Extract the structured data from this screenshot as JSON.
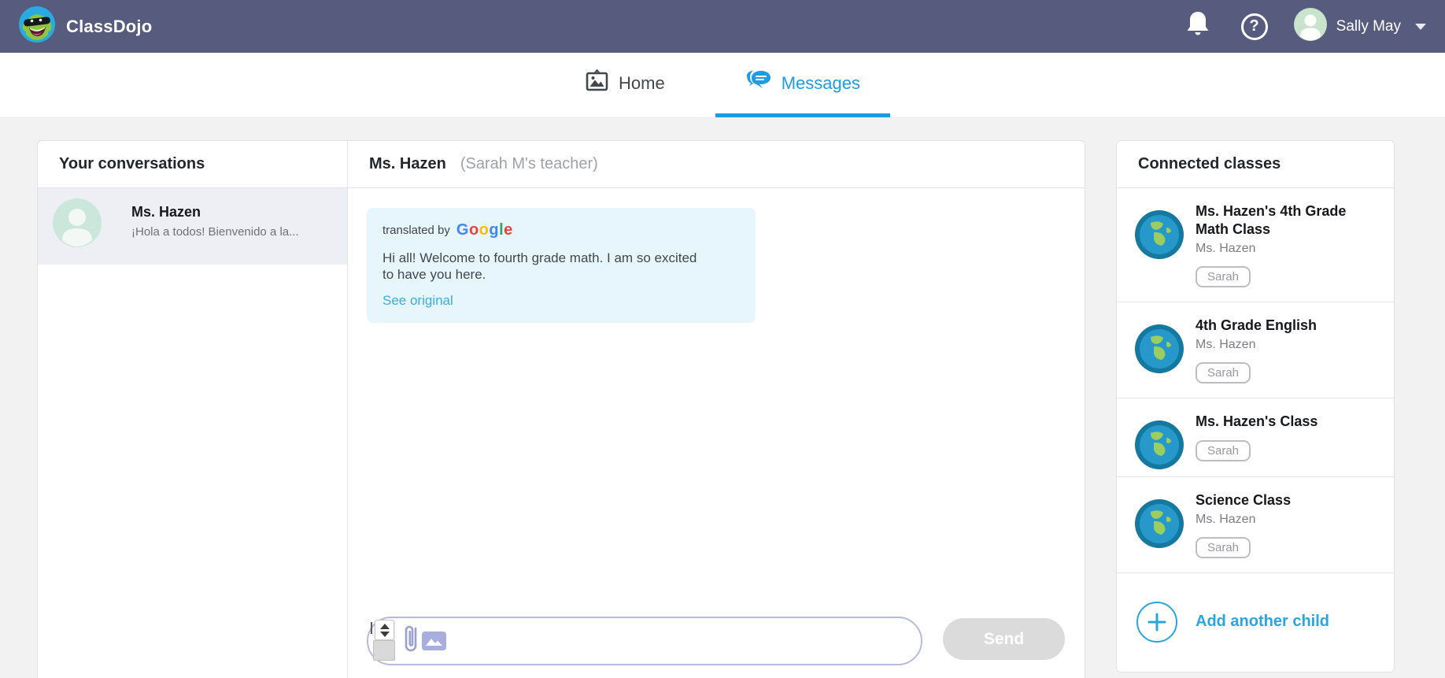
{
  "navbar": {
    "brand": "ClassDojo",
    "user_name": "Sally May",
    "help_glyph": "?"
  },
  "tabs": {
    "home_label": "Home",
    "messages_label": "Messages",
    "active_tab": "Messages"
  },
  "conversations": {
    "title": "Your conversations",
    "items": [
      {
        "name": "Ms. Hazen",
        "preview": "¡Hola a todos! Bienvenido a la..."
      }
    ]
  },
  "thread": {
    "name": "Ms. Hazen",
    "subtitle": "(Sarah M's teacher)",
    "message": {
      "translated_by": "translated by",
      "google_letters": [
        "G",
        "o",
        "o",
        "g",
        "l",
        "e"
      ],
      "text": "Hi all! Welcome to fourth grade math. I am so excited to have you here.",
      "see_original": "See original"
    },
    "composer": {
      "value": "",
      "send_label": "Send"
    }
  },
  "connected_classes": {
    "title": "Connected classes",
    "items": [
      {
        "name": "Ms. Hazen's 4th Grade Math Class",
        "teacher": "Ms. Hazen",
        "student_tag": "Sarah"
      },
      {
        "name": "4th Grade English",
        "teacher": "Ms. Hazen",
        "student_tag": "Sarah"
      },
      {
        "name": "Ms. Hazen's Class",
        "teacher": "",
        "student_tag": "Sarah"
      },
      {
        "name": "Science Class",
        "teacher": "Ms. Hazen",
        "student_tag": "Sarah"
      }
    ],
    "add_child_label": "Add another child"
  },
  "colors": {
    "accent_blue": "#1E9CE2",
    "navbar_bg": "#575B7D",
    "bubble_bg": "#E7F6FD",
    "send_disabled_bg": "#DBDBDB",
    "selected_conversation_bg": "#EDEFF4",
    "google_letter_colors": [
      "#4285F4",
      "#EA4335",
      "#FBBC05",
      "#4285F4",
      "#34A853",
      "#EA4335"
    ]
  }
}
